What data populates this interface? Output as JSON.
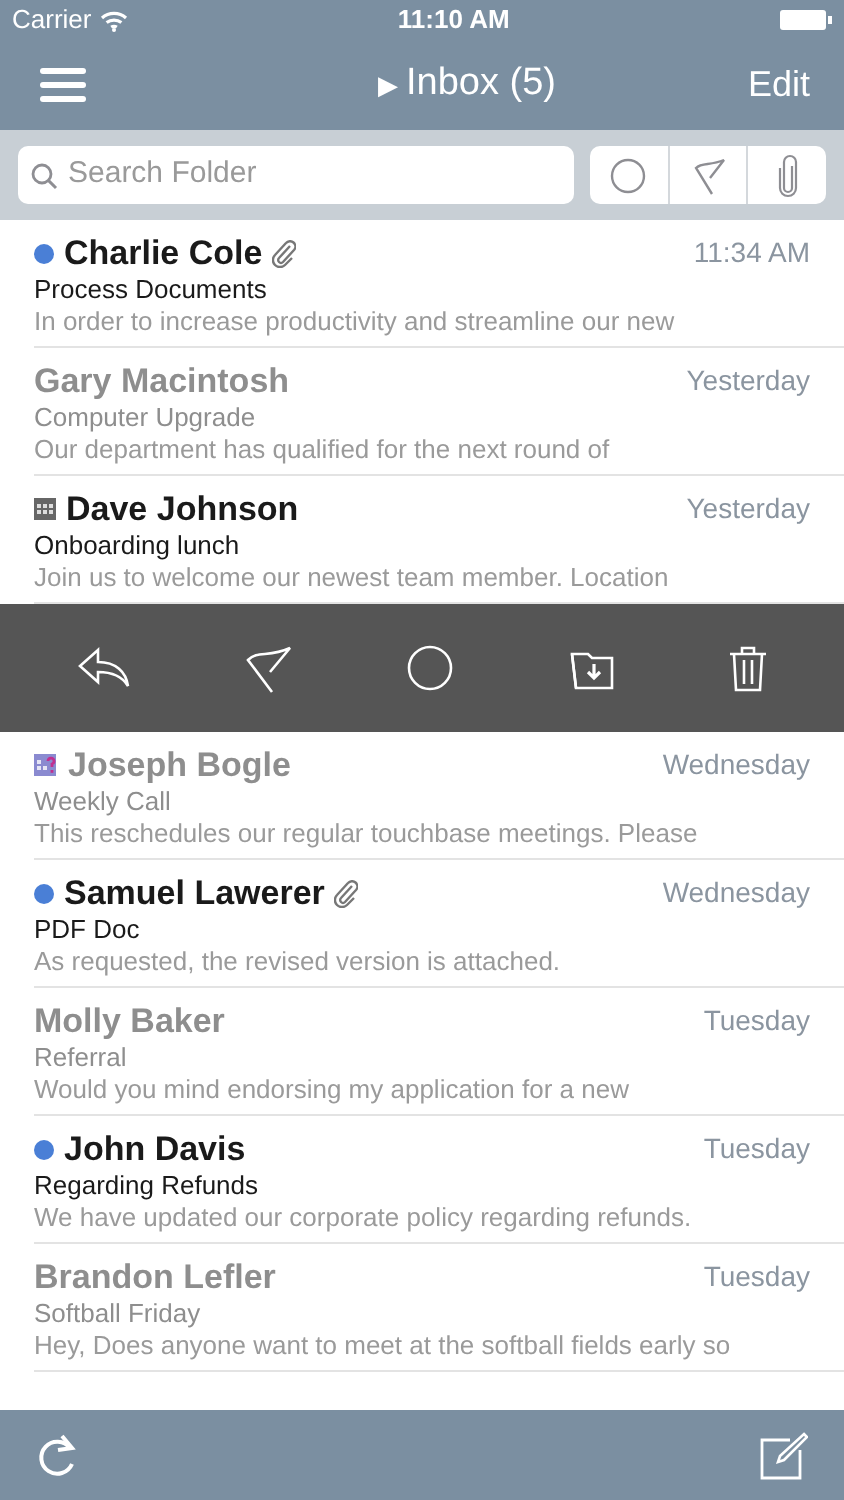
{
  "status_bar": {
    "carrier": "Carrier",
    "time": "11:10 AM"
  },
  "nav": {
    "title": "Inbox (5)",
    "title_marker": "▶",
    "edit": "Edit"
  },
  "search": {
    "placeholder": "Search Folder"
  },
  "messages": [
    {
      "sender": "Charlie Cole",
      "subject": "Process Documents",
      "preview": "In order to increase productivity and streamline our new",
      "date": "11:34 AM",
      "unread": true,
      "marked": true,
      "kind": "attachment",
      "expanded": false
    },
    {
      "sender": "Gary Macintosh",
      "subject": "Computer Upgrade",
      "preview": "Our department has qualified for the next round of",
      "date": "Yesterday",
      "unread": false,
      "marked": false,
      "kind": "plain",
      "expanded": false
    },
    {
      "sender": "Dave Johnson",
      "subject": "Onboarding lunch",
      "preview": "Join us to welcome our newest team member. Location",
      "date": "Yesterday",
      "unread": true,
      "marked": false,
      "kind": "event",
      "expanded": true
    },
    {
      "sender": "Joseph Bogle",
      "subject": "Weekly Call",
      "preview": "This reschedules our regular touchbase meetings. Please",
      "date": "Wednesday",
      "unread": false,
      "marked": false,
      "kind": "invite",
      "expanded": false
    },
    {
      "sender": "Samuel Lawerer",
      "subject": "PDF Doc",
      "preview": "As requested, the revised version is attached.",
      "date": "Wednesday",
      "unread": true,
      "marked": true,
      "kind": "attachment",
      "expanded": false
    },
    {
      "sender": "Molly Baker",
      "subject": "Referral",
      "preview": "Would you mind endorsing my application for a new",
      "date": "Tuesday",
      "unread": false,
      "marked": false,
      "kind": "plain",
      "expanded": false
    },
    {
      "sender": "John Davis",
      "subject": "Regarding Refunds",
      "preview": "We have updated our corporate policy regarding refunds.",
      "date": "Tuesday",
      "unread": true,
      "marked": true,
      "kind": "plain",
      "expanded": false
    },
    {
      "sender": "Brandon Lefler",
      "subject": "Softball Friday",
      "preview": "Hey, Does anyone want to meet at the softball fields early so",
      "date": "Tuesday",
      "unread": false,
      "marked": false,
      "kind": "plain",
      "expanded": false
    }
  ]
}
